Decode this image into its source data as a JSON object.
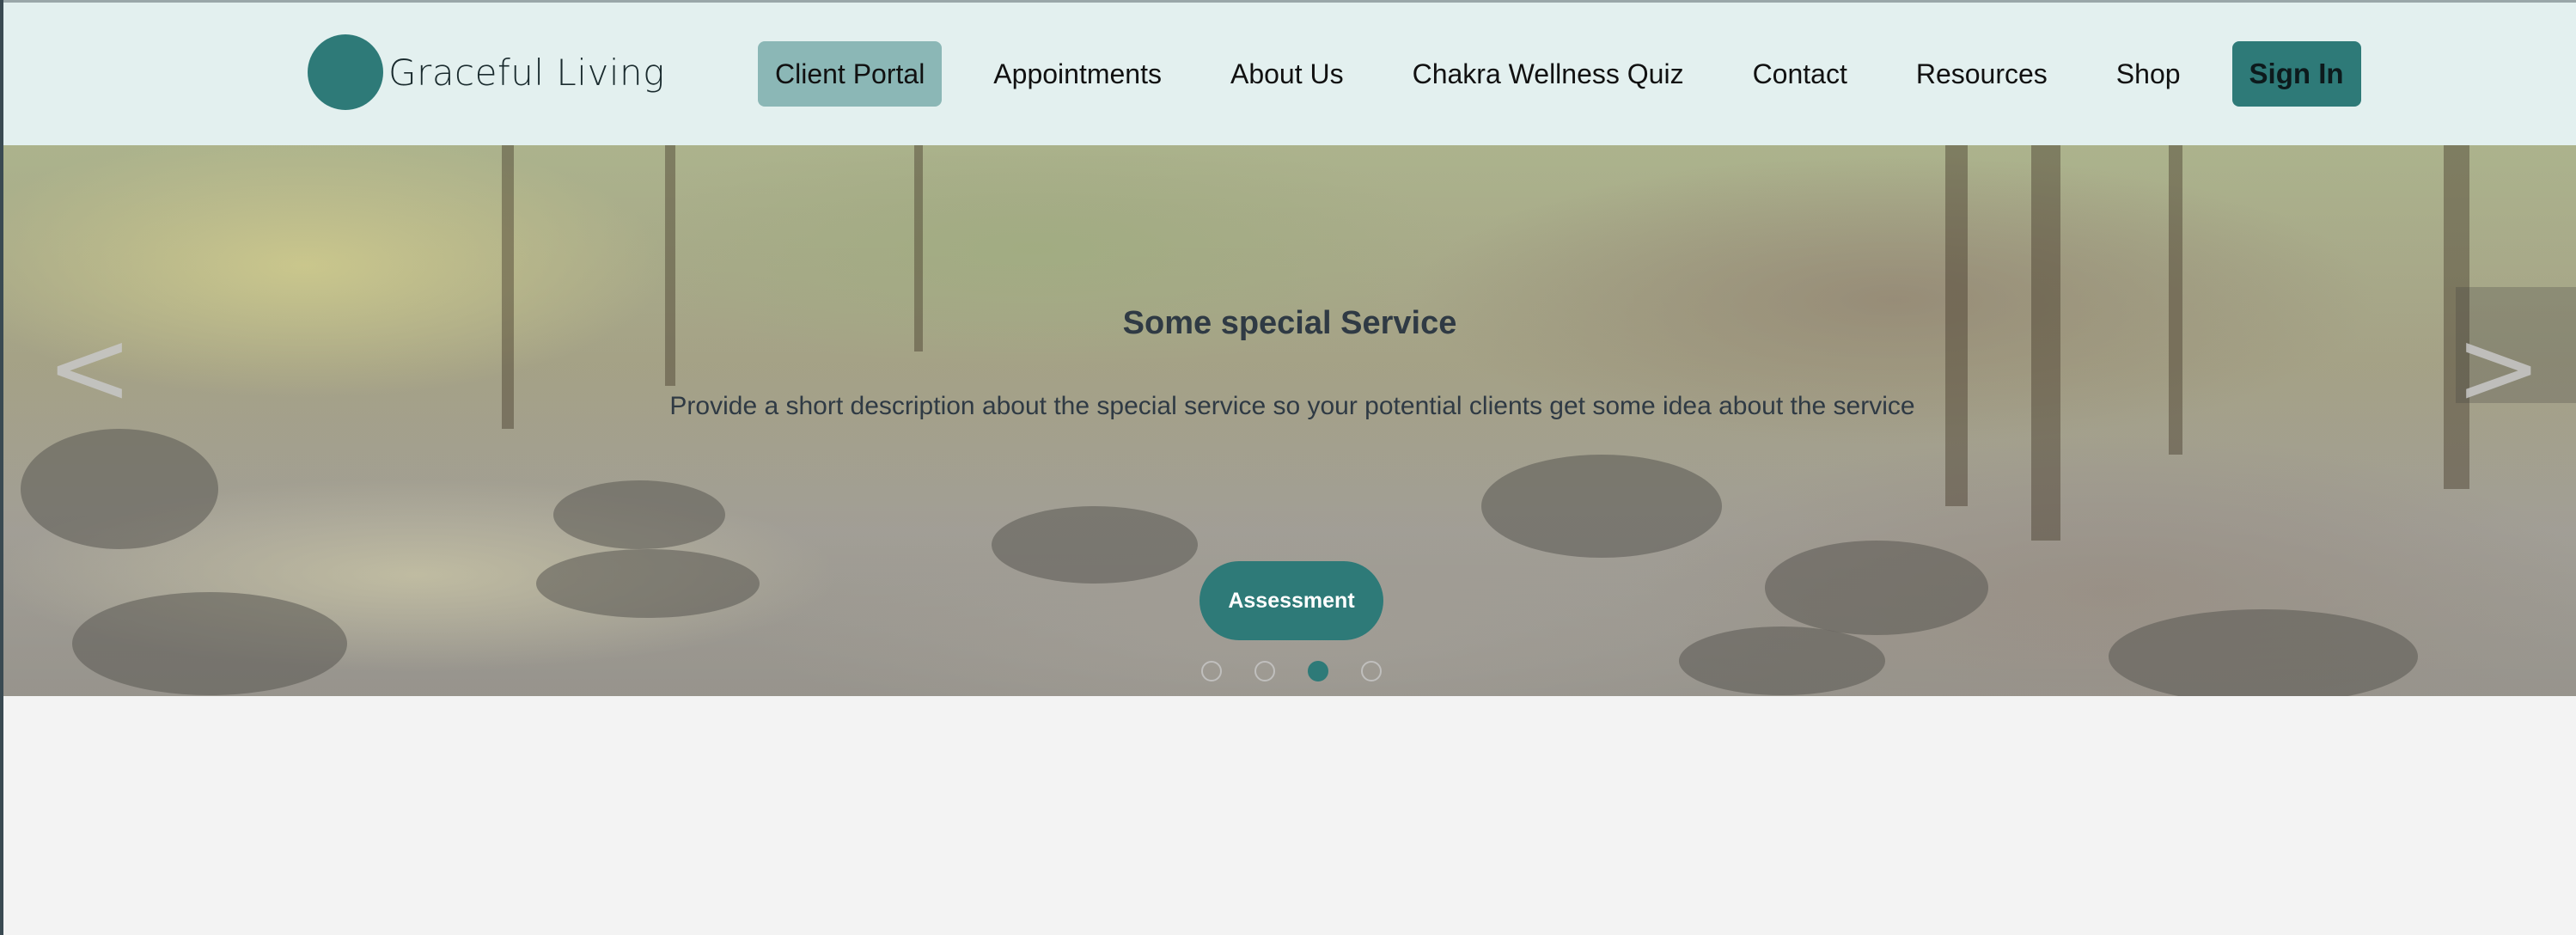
{
  "brand": {
    "name": "Graceful Living"
  },
  "nav": {
    "items": [
      {
        "label": "Client Portal",
        "active": true
      },
      {
        "label": "Appointments"
      },
      {
        "label": "About Us"
      },
      {
        "label": "Chakra Wellness Quiz"
      },
      {
        "label": "Contact"
      },
      {
        "label": "Resources"
      },
      {
        "label": "Shop"
      }
    ],
    "signin_label": "Sign In"
  },
  "hero": {
    "title": "Some special Service",
    "description": "Provide a short description about the special service so your potential clients get some idea about the service",
    "button_label": "Assessment",
    "prev_arrow": "<",
    "next_arrow": ">",
    "slide_count": 4,
    "active_slide": 3
  },
  "colors": {
    "accent": "#2e7a78",
    "nav_bg": "#e3f0ef",
    "active_nav": "#8bb7b6",
    "page_bg": "#f3f3f3"
  }
}
